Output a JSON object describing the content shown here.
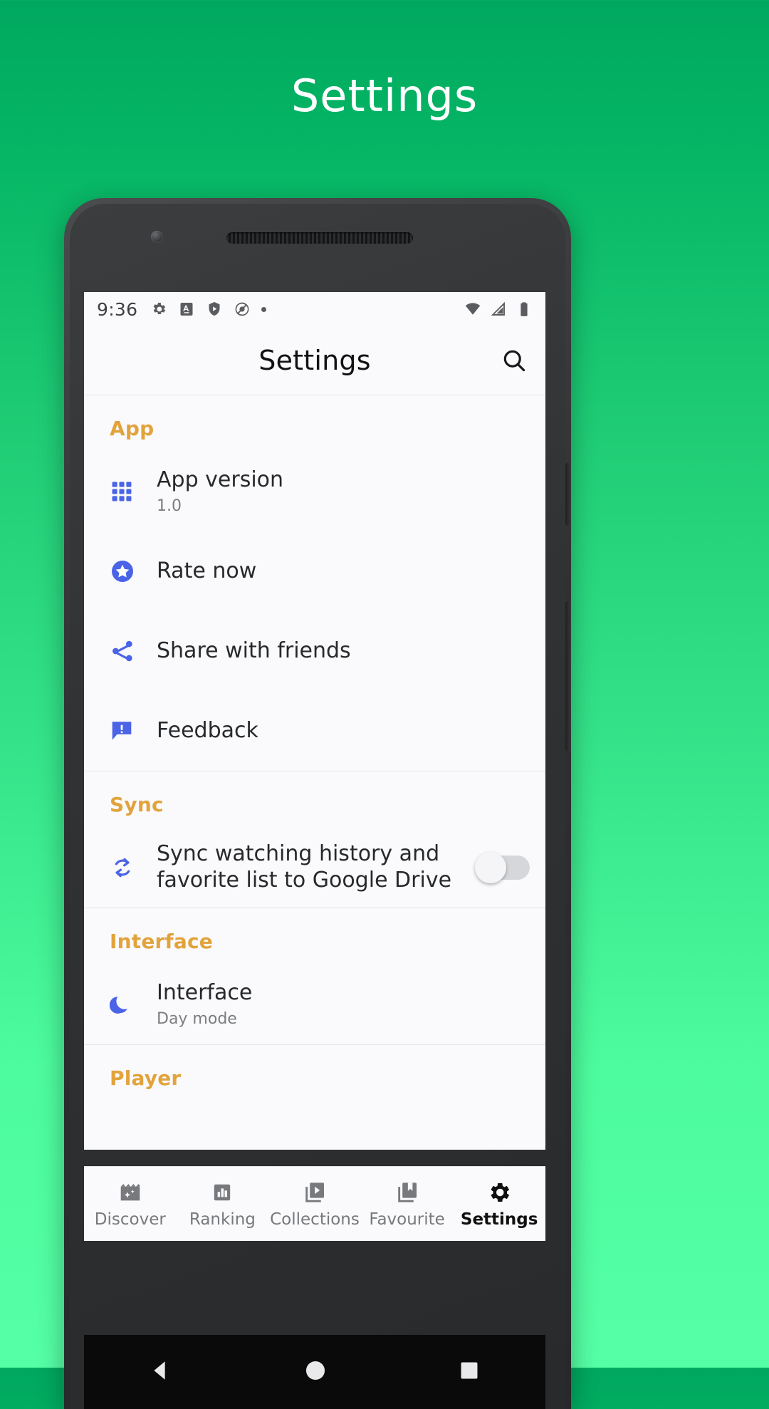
{
  "promo": {
    "title": "Settings"
  },
  "status_bar": {
    "time": "9:36",
    "left_icons": [
      "gear-icon",
      "font-size-a-icon",
      "shield-play-icon",
      "adblock-circle-icon",
      "dot-icon"
    ],
    "right_icons": [
      "wifi-icon",
      "signal-icon",
      "battery-icon"
    ]
  },
  "app_bar": {
    "title": "Settings",
    "search_icon": "search-icon"
  },
  "colors": {
    "section_header": "#e2a33c",
    "accent_icon": "#4a63e7",
    "title_text": "#27292c",
    "subtitle_text": "#7b7d80",
    "screen_bg": "#fafafc",
    "promo_bg_top": "#00a85f",
    "promo_bg_bottom": "#55ffa6"
  },
  "sections": [
    {
      "header": "App",
      "rows": [
        {
          "icon": "grid-apps-icon",
          "title": "App version",
          "subtitle": "1.0",
          "toggle": null
        },
        {
          "icon": "star-circle-icon",
          "title": "Rate now",
          "subtitle": null,
          "toggle": null
        },
        {
          "icon": "share-icon",
          "title": "Share with friends",
          "subtitle": null,
          "toggle": null
        },
        {
          "icon": "feedback-bubble-icon",
          "title": "Feedback",
          "subtitle": null,
          "toggle": null
        }
      ]
    },
    {
      "header": "Sync",
      "rows": [
        {
          "icon": "sync-refresh-icon",
          "title": "Sync watching history and favorite list to Google Drive",
          "subtitle": null,
          "toggle": "off"
        }
      ]
    },
    {
      "header": "Interface",
      "rows": [
        {
          "icon": "moon-icon",
          "title": "Interface",
          "subtitle": "Day mode",
          "toggle": null
        }
      ]
    },
    {
      "header": "Player",
      "rows": []
    }
  ],
  "bottom_nav": {
    "items": [
      {
        "label": "Discover",
        "icon": "clapperboard-sparkle-icon",
        "active": false
      },
      {
        "label": "Ranking",
        "icon": "bar-chart-icon",
        "active": false
      },
      {
        "label": "Collections",
        "icon": "video-collection-icon",
        "active": false
      },
      {
        "label": "Favourite",
        "icon": "bookmark-collection-icon",
        "active": false
      },
      {
        "label": "Settings",
        "icon": "gear-icon",
        "active": true
      }
    ]
  },
  "system_nav": {
    "back": "back-triangle-icon",
    "home": "home-circle-icon",
    "recents": "recents-square-icon"
  }
}
